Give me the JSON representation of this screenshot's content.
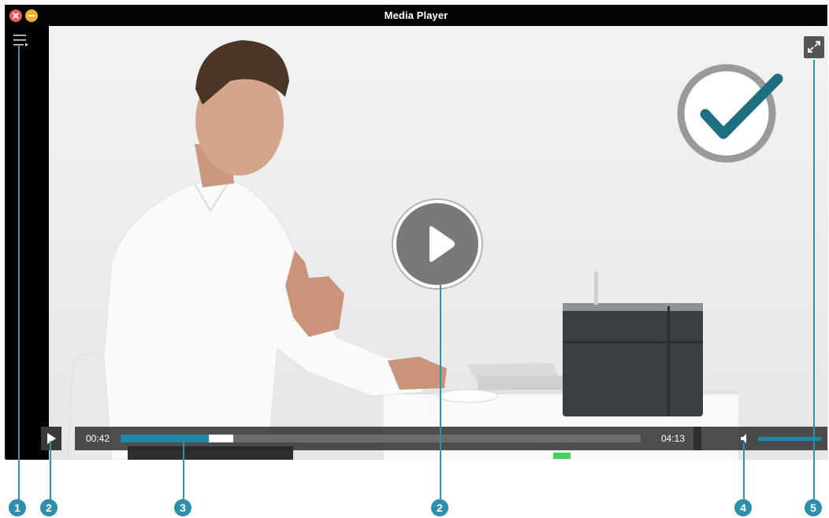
{
  "window": {
    "title": "Media Player"
  },
  "player": {
    "current_time": "00:42",
    "duration": "04:13",
    "progress_played_fraction": 0.17,
    "progress_buffered_fraction": 0.216,
    "volume_level_fraction": 1.0
  },
  "callouts": [
    "1",
    "2",
    "3",
    "2",
    "4",
    "5"
  ],
  "colors": {
    "accent": "#1f88a8",
    "callout": "#2d8fae",
    "close": "#f25757",
    "minimize": "#f5b12b",
    "checkmark": "#1e6f82"
  },
  "icons": {
    "close": "close-icon",
    "minimize": "minimize-icon",
    "playlist": "playlist-icon",
    "fullscreen": "fullscreen-icon",
    "play": "play-icon",
    "volume": "volume-icon",
    "check": "checkmark-icon"
  }
}
